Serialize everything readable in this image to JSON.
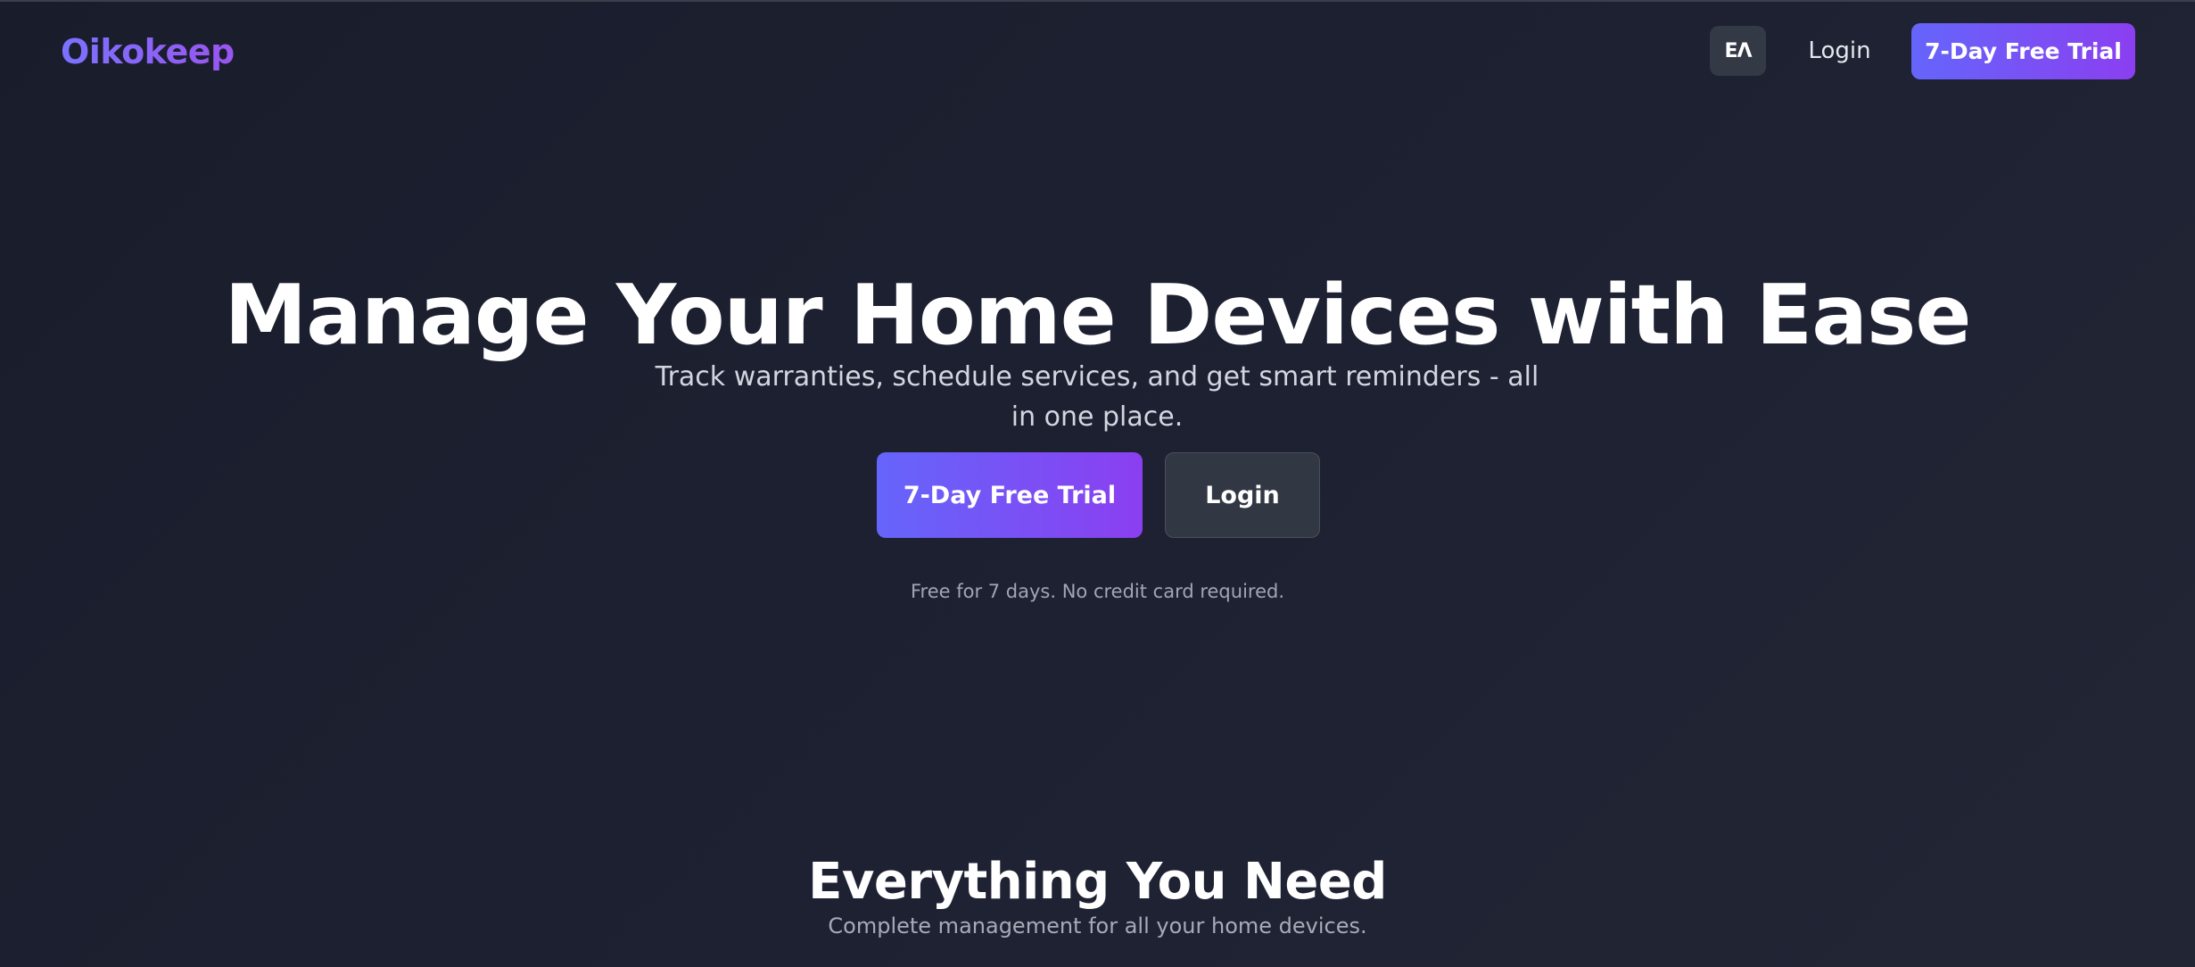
{
  "header": {
    "brand": "Oikokeep",
    "language_label": "EΛ",
    "login_label": "Login",
    "trial_label": "7-Day Free Trial"
  },
  "hero": {
    "title": "Manage Your Home Devices with Ease",
    "subtitle": "Track warranties, schedule services, and get smart reminders - all in one place.",
    "primary_cta": "7-Day Free Trial",
    "secondary_cta": "Login",
    "note": "Free for 7 days. No credit card required."
  },
  "features": {
    "title": "Everything You Need",
    "subtitle": "Complete management for all your home devices."
  },
  "colors": {
    "background": "#1c2030",
    "accent_start": "#6565fb",
    "accent_end": "#8b3ff0",
    "secondary_button": "#323744"
  }
}
